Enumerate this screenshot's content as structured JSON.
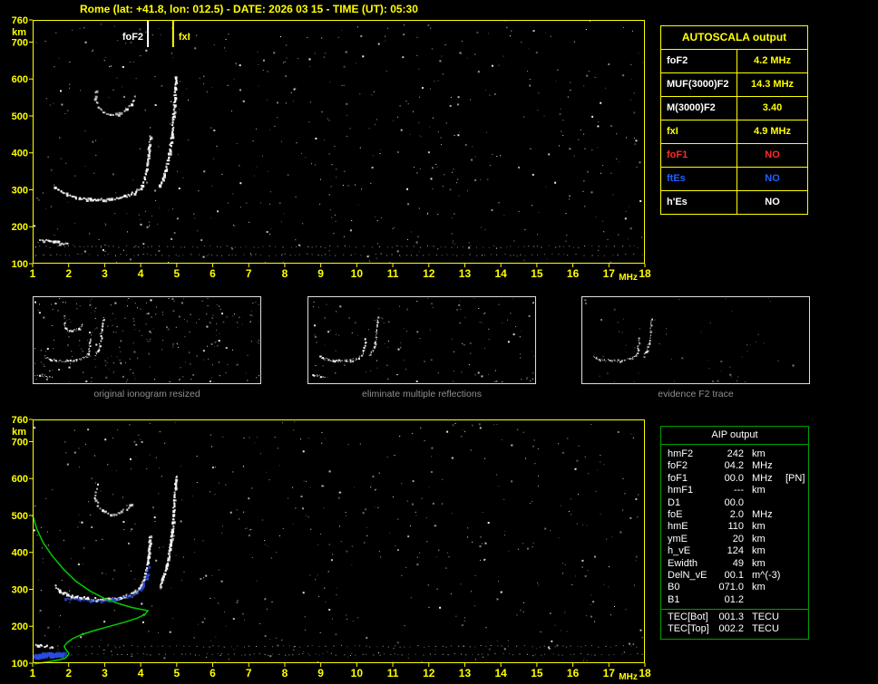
{
  "title": "Rome (lat: +41.8, lon: 012.5) - DATE: 2026 03 15 - TIME (UT): 05:30",
  "colors": {
    "accent_yellow": "#ffff00",
    "trace_white": "#ffffff",
    "profile_green": "#00cc00",
    "restored_blue": "#2b4bdf",
    "alert_red": "#ff2a2a",
    "es_blue": "#2060ff",
    "caption_gray": "#8f8f8f",
    "aip_green": "#00a000",
    "thumb_border": "#dedede"
  },
  "autoscala_table": {
    "title": "AUTOSCALA output",
    "rows": [
      {
        "label": "foF2",
        "value": "4.2 MHz",
        "label_color": "#ffffff",
        "value_color": "#ffff00"
      },
      {
        "label": "MUF(3000)F2",
        "value": "14.3 MHz",
        "label_color": "#ffffff",
        "value_color": "#ffff00"
      },
      {
        "label": "M(3000)F2",
        "value": "3.40",
        "label_color": "#ffffff",
        "value_color": "#ffff00"
      },
      {
        "label": "fxI",
        "value": "4.9 MHz",
        "label_color": "#ffff00",
        "value_color": "#ffff00"
      },
      {
        "label": "foF1",
        "value": "NO",
        "label_color": "#ff2a2a",
        "value_color": "#ff2a2a"
      },
      {
        "label": "ftEs",
        "value": "NO",
        "label_color": "#2060ff",
        "value_color": "#2060ff"
      },
      {
        "label": "h'Es",
        "value": "NO",
        "label_color": "#ffffff",
        "value_color": "#ffffff"
      }
    ]
  },
  "aip_table": {
    "title": "AIP output",
    "rows": [
      {
        "label": "hmF2",
        "value": "242",
        "unit": "km",
        "note": ""
      },
      {
        "label": "foF2",
        "value": "04.2",
        "unit": "MHz",
        "note": ""
      },
      {
        "label": "foF1",
        "value": "00.0",
        "unit": "MHz",
        "note": "[PN]"
      },
      {
        "label": "hmF1",
        "value": "---",
        "unit": "km",
        "note": ""
      },
      {
        "label": "D1",
        "value": "00.0",
        "unit": "",
        "note": ""
      },
      {
        "label": "foE",
        "value": "2.0",
        "unit": "MHz",
        "note": ""
      },
      {
        "label": "hmE",
        "value": "110",
        "unit": "km",
        "note": ""
      },
      {
        "label": "ymE",
        "value": "20",
        "unit": "km",
        "note": ""
      },
      {
        "label": "h_vE",
        "value": "124",
        "unit": "km",
        "note": ""
      },
      {
        "label": "Ewidth",
        "value": "49",
        "unit": "km",
        "note": ""
      },
      {
        "label": "DelN_vE",
        "value": "00.1",
        "unit": "m^(-3)",
        "note": ""
      },
      {
        "label": "B0",
        "value": "071.0",
        "unit": "km",
        "note": ""
      },
      {
        "label": "B1",
        "value": "01.2",
        "unit": "",
        "note": ""
      }
    ],
    "tec_rows": [
      {
        "label": "TEC[Bot]",
        "value": "001.3",
        "unit": "TECU"
      },
      {
        "label": "TEC[Top]",
        "value": "002.2",
        "unit": "TECU"
      }
    ]
  },
  "thumbnails": [
    {
      "caption": "original ionogram resized"
    },
    {
      "caption": "eliminate multiple reflections"
    },
    {
      "caption": "evidence F2 trace"
    }
  ],
  "chart_data": [
    {
      "id": "main_ionogram",
      "type": "scatter",
      "title": "recorded ionogram (virtual height vs frequency)",
      "xlabel": "MHz",
      "ylabel": "km",
      "xlim": [
        1,
        18
      ],
      "ylim": [
        100,
        760
      ],
      "xticks": [
        1,
        2,
        3,
        4,
        5,
        6,
        7,
        8,
        9,
        10,
        11,
        12,
        13,
        14,
        15,
        16,
        17,
        18
      ],
      "yticks": [
        760,
        700,
        600,
        500,
        400,
        300,
        200,
        100
      ],
      "grid": false,
      "markers": [
        {
          "label": "foF2",
          "freq_mhz": 4.2,
          "color": "#ffffff"
        },
        {
          "label": "fxI",
          "freq_mhz": 4.9,
          "color": "#ffff00"
        }
      ],
      "series": [
        {
          "name": "F2-trace-O-mode",
          "color": "#ffffff",
          "points": [
            [
              1.6,
              310
            ],
            [
              1.75,
              297
            ],
            [
              1.95,
              288
            ],
            [
              2.2,
              281
            ],
            [
              2.5,
              277
            ],
            [
              2.8,
              275
            ],
            [
              3.1,
              276
            ],
            [
              3.4,
              280
            ],
            [
              3.65,
              287
            ],
            [
              3.85,
              297
            ],
            [
              4.0,
              311
            ],
            [
              4.08,
              329
            ],
            [
              4.14,
              352
            ],
            [
              4.18,
              380
            ],
            [
              4.21,
              412
            ],
            [
              4.24,
              448
            ]
          ]
        },
        {
          "name": "F2-trace-X-mode",
          "color": "#ffffff",
          "points": [
            [
              4.5,
              312
            ],
            [
              4.6,
              332
            ],
            [
              4.68,
              357
            ],
            [
              4.75,
              387
            ],
            [
              4.81,
              422
            ],
            [
              4.86,
              462
            ],
            [
              4.89,
              502
            ],
            [
              4.92,
              542
            ],
            [
              4.94,
              577
            ],
            [
              4.96,
              607
            ]
          ]
        },
        {
          "name": "second-hop-reflection",
          "color": "#ffffff",
          "points": [
            [
              2.75,
              572
            ],
            [
              2.72,
              549
            ],
            [
              2.8,
              528
            ],
            [
              2.95,
              512
            ],
            [
              3.15,
              505
            ],
            [
              3.38,
              508
            ],
            [
              3.58,
              519
            ],
            [
              3.72,
              534
            ],
            [
              3.82,
              553
            ]
          ]
        },
        {
          "name": "E-region-echo",
          "color": "#ffffff",
          "points": [
            [
              1.2,
              168
            ],
            [
              1.45,
              163
            ],
            [
              1.7,
              159
            ],
            [
              1.95,
              156
            ]
          ]
        }
      ]
    },
    {
      "id": "aip_ionogram",
      "type": "scatter",
      "title": "ionogram with restored trace and electron density profile",
      "xlabel": "MHz",
      "ylabel": "km",
      "xlim": [
        1,
        18
      ],
      "ylim": [
        100,
        760
      ],
      "xticks": [
        1,
        2,
        3,
        4,
        5,
        6,
        7,
        8,
        9,
        10,
        11,
        12,
        13,
        14,
        15,
        16,
        17,
        18
      ],
      "yticks": [
        760,
        700,
        600,
        500,
        400,
        300,
        200,
        100
      ],
      "grid": false,
      "series": [
        {
          "name": "F2-trace-O-mode",
          "color": "#ffffff",
          "points": [
            [
              1.6,
              310
            ],
            [
              1.75,
              297
            ],
            [
              1.95,
              288
            ],
            [
              2.2,
              281
            ],
            [
              2.5,
              277
            ],
            [
              2.8,
              275
            ],
            [
              3.1,
              276
            ],
            [
              3.4,
              280
            ],
            [
              3.65,
              287
            ],
            [
              3.85,
              297
            ],
            [
              4.0,
              311
            ],
            [
              4.08,
              329
            ],
            [
              4.14,
              352
            ],
            [
              4.18,
              380
            ],
            [
              4.21,
              412
            ],
            [
              4.24,
              448
            ]
          ]
        },
        {
          "name": "F2-trace-X-mode",
          "color": "#ffffff",
          "points": [
            [
              4.5,
              312
            ],
            [
              4.6,
              332
            ],
            [
              4.68,
              357
            ],
            [
              4.75,
              387
            ],
            [
              4.81,
              422
            ],
            [
              4.86,
              462
            ],
            [
              4.89,
              502
            ],
            [
              4.92,
              542
            ],
            [
              4.94,
              577
            ],
            [
              4.96,
              607
            ]
          ]
        },
        {
          "name": "second-hop-reflection",
          "color": "#ffffff",
          "points": [
            [
              2.75,
              572
            ],
            [
              2.72,
              549
            ],
            [
              2.8,
              528
            ],
            [
              2.95,
              512
            ],
            [
              3.15,
              505
            ],
            [
              3.38,
              508
            ],
            [
              3.58,
              519
            ],
            [
              3.72,
              534
            ]
          ]
        },
        {
          "name": "E-region-echo",
          "color": "#ffffff",
          "points": [
            [
              1.05,
              152
            ],
            [
              1.3,
              148
            ],
            [
              1.55,
              145
            ]
          ]
        },
        {
          "name": "restored-trace",
          "color": "#2b4bdf",
          "points": [
            [
              1.9,
              279
            ],
            [
              2.25,
              274
            ],
            [
              2.6,
              271
            ],
            [
              3.0,
              272
            ],
            [
              3.35,
              276
            ],
            [
              3.65,
              283
            ],
            [
              3.88,
              294
            ],
            [
              4.05,
              310
            ],
            [
              4.14,
              333
            ],
            [
              4.19,
              362
            ]
          ]
        },
        {
          "name": "Es-patch",
          "color": "#2b4bdf",
          "points": [
            [
              1.02,
              124
            ],
            [
              1.25,
              126
            ],
            [
              1.45,
              127
            ],
            [
              1.65,
              128
            ],
            [
              1.82,
              129
            ]
          ]
        }
      ],
      "profile": {
        "name": "electron-density-profile",
        "color": "#00cc00",
        "points": [
          [
            1.0,
            500
          ],
          [
            1.12,
            462
          ],
          [
            1.3,
            425
          ],
          [
            1.55,
            390
          ],
          [
            1.85,
            355
          ],
          [
            2.2,
            322
          ],
          [
            2.6,
            295
          ],
          [
            3.0,
            275
          ],
          [
            3.4,
            261
          ],
          [
            3.75,
            251
          ],
          [
            4.05,
            245
          ],
          [
            4.2,
            242
          ],
          [
            4.12,
            232
          ],
          [
            3.9,
            222
          ],
          [
            3.55,
            211
          ],
          [
            3.1,
            199
          ],
          [
            2.7,
            188
          ],
          [
            2.35,
            177
          ],
          [
            2.1,
            166
          ],
          [
            1.95,
            155
          ],
          [
            1.88,
            146
          ],
          [
            1.92,
            137
          ],
          [
            2.0,
            128
          ],
          [
            2.0,
            124
          ],
          [
            1.95,
            118
          ],
          [
            1.9,
            113
          ],
          [
            1.75,
            109
          ],
          [
            1.5,
            105
          ],
          [
            1.25,
            101
          ],
          [
            1.05,
            98
          ]
        ]
      }
    },
    {
      "id": "thumbnails",
      "type": "scatter",
      "title": "processing-step thumbnails (reuse main ionogram trace)",
      "xlim": [
        1,
        14
      ],
      "ylim": [
        100,
        760
      ]
    }
  ]
}
